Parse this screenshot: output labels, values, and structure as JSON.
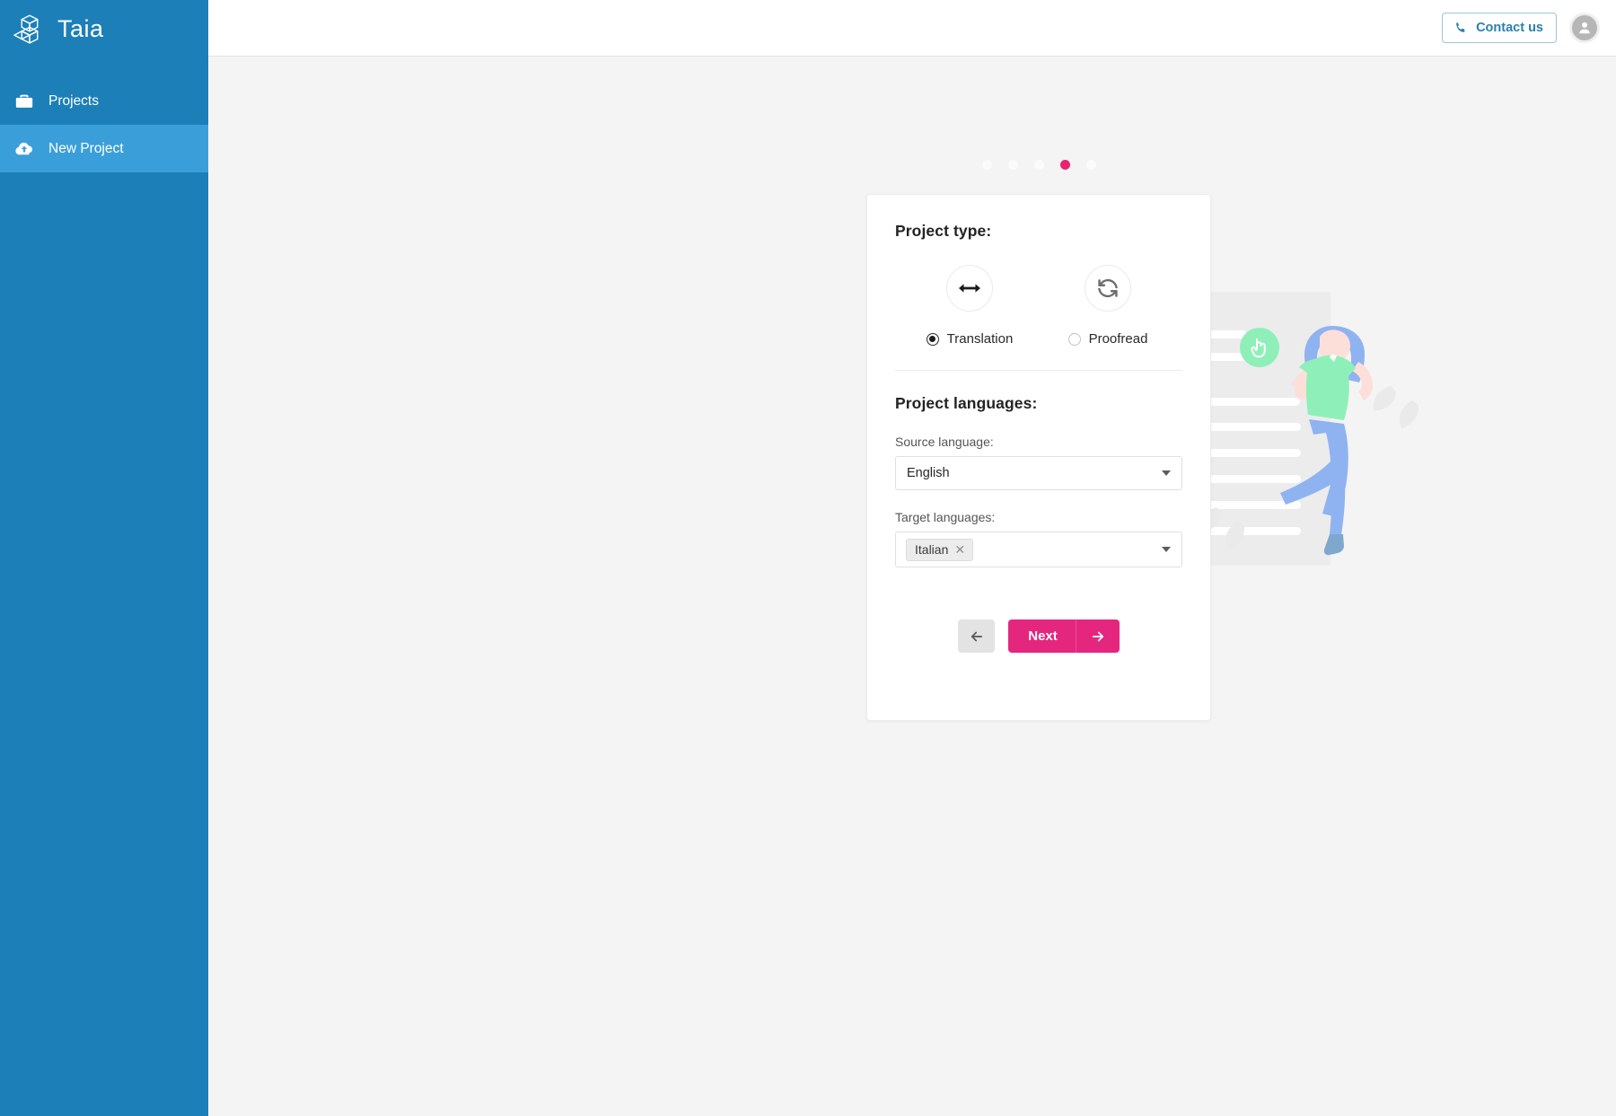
{
  "sidebar": {
    "brand": {
      "name": "Taia",
      "logo_icon": "cubes-logo-icon"
    },
    "items": [
      {
        "label": "Projects",
        "icon": "briefcase-icon",
        "active": false
      },
      {
        "label": "New Project",
        "icon": "cloud-upload-icon",
        "active": true
      }
    ]
  },
  "topbar": {
    "contact_label": "Contact us",
    "contact_icon": "phone-icon",
    "avatar_icon": "user-avatar-icon"
  },
  "wizard": {
    "steps": {
      "total": 5,
      "current": 4
    },
    "project_type": {
      "heading": "Project type:",
      "options": [
        {
          "label": "Translation",
          "icon": "left-right-arrow-icon",
          "selected": true
        },
        {
          "label": "Proofread",
          "icon": "refresh-sync-icon",
          "selected": false
        }
      ]
    },
    "project_languages": {
      "heading": "Project languages:",
      "source": {
        "label": "Source language:",
        "value": "English",
        "caret_icon": "chevron-down-icon"
      },
      "target": {
        "label": "Target languages:",
        "chips": [
          {
            "label": "Italian",
            "remove_icon": "close-icon"
          }
        ],
        "caret_icon": "chevron-down-icon"
      }
    },
    "actions": {
      "back_icon": "arrow-left-icon",
      "next_label": "Next",
      "next_icon": "arrow-right-icon"
    }
  },
  "colors": {
    "sidebar_bg": "#1c7fb8",
    "sidebar_active": "#3a9fd9",
    "accent_pink": "#e5267f",
    "step_active": "#e8246f",
    "link_blue": "#2b7fae",
    "page_bg": "#f4f4f4"
  },
  "illustration": {
    "name": "woman-with-document-illustration",
    "badge_icon": "pointer-hand-icon"
  }
}
